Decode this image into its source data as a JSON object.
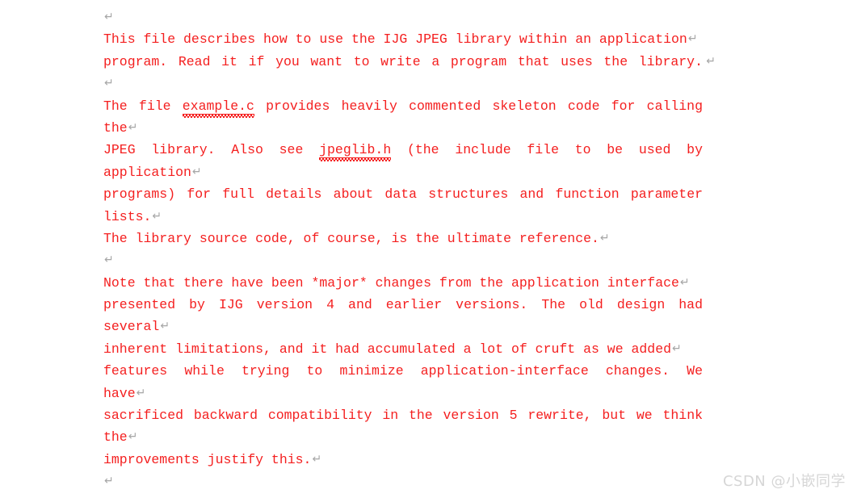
{
  "document": {
    "text_color": "#f41f1f",
    "return_mark_color": "#a6a6a6",
    "background": "#ffffff",
    "return_glyph": "↵",
    "lines": [
      {
        "id": "l01",
        "kind": "blank",
        "text": "",
        "return_mark": true,
        "justified": false
      },
      {
        "id": "l02",
        "kind": "text",
        "text": "This file describes how to use the IJG JPEG library within an application",
        "return_mark": true,
        "justified": false
      },
      {
        "id": "l03",
        "kind": "text",
        "text": "program.  Read it if you want to write a program that uses the library.",
        "return_mark": true,
        "justified": true
      },
      {
        "id": "l04",
        "kind": "blank",
        "text": "",
        "return_mark": true,
        "justified": false
      },
      {
        "id": "l05",
        "kind": "text-spell",
        "pre": "The file ",
        "spell": "example.c",
        "post": " provides heavily commented skeleton code for calling",
        "return_mark": false,
        "justified": true
      },
      {
        "id": "l06",
        "kind": "text",
        "text": "the",
        "return_mark": true,
        "justified": false
      },
      {
        "id": "l07",
        "kind": "text-spell",
        "pre": "JPEG library.  Also see ",
        "spell": "jpeglib.h",
        "post": " (the include file to be used by",
        "return_mark": false,
        "justified": true
      },
      {
        "id": "l08",
        "kind": "text",
        "text": "application",
        "return_mark": true,
        "justified": false
      },
      {
        "id": "l09",
        "kind": "text",
        "text": "programs) for full details about data structures and function parameter",
        "return_mark": false,
        "justified": true
      },
      {
        "id": "l10",
        "kind": "text",
        "text": "lists.",
        "return_mark": true,
        "justified": false
      },
      {
        "id": "l11",
        "kind": "text",
        "text": "The library source code, of course, is the ultimate reference.",
        "return_mark": true,
        "justified": false
      },
      {
        "id": "l12",
        "kind": "blank",
        "text": "",
        "return_mark": true,
        "justified": false
      },
      {
        "id": "l13",
        "kind": "text",
        "text": "Note that there have been *major* changes from the application interface",
        "return_mark": true,
        "justified": false
      },
      {
        "id": "l14",
        "kind": "text",
        "text": "presented by IJG version 4 and earlier versions.  The old design had",
        "return_mark": false,
        "justified": true
      },
      {
        "id": "l15",
        "kind": "text",
        "text": "several",
        "return_mark": true,
        "justified": false
      },
      {
        "id": "l16",
        "kind": "text",
        "text": "inherent limitations, and it had accumulated a lot of cruft as we added",
        "return_mark": true,
        "justified": false
      },
      {
        "id": "l17",
        "kind": "text",
        "text": "features while trying to minimize application-interface changes.  We",
        "return_mark": false,
        "justified": true
      },
      {
        "id": "l18",
        "kind": "text",
        "text": "have",
        "return_mark": true,
        "justified": false
      },
      {
        "id": "l19",
        "kind": "text",
        "text": "sacrificed backward compatibility in the version 5 rewrite, but we think",
        "return_mark": false,
        "justified": true
      },
      {
        "id": "l20",
        "kind": "text",
        "text": "the",
        "return_mark": true,
        "justified": false
      },
      {
        "id": "l21",
        "kind": "text",
        "text": "improvements justify this.",
        "return_mark": true,
        "justified": false
      },
      {
        "id": "l22",
        "kind": "blank",
        "text": "",
        "return_mark": true,
        "justified": false
      }
    ],
    "clipped_line": {
      "text": "."
    }
  },
  "watermark": {
    "text": "CSDN @小嵌同学",
    "color": "#d6d6d6"
  }
}
